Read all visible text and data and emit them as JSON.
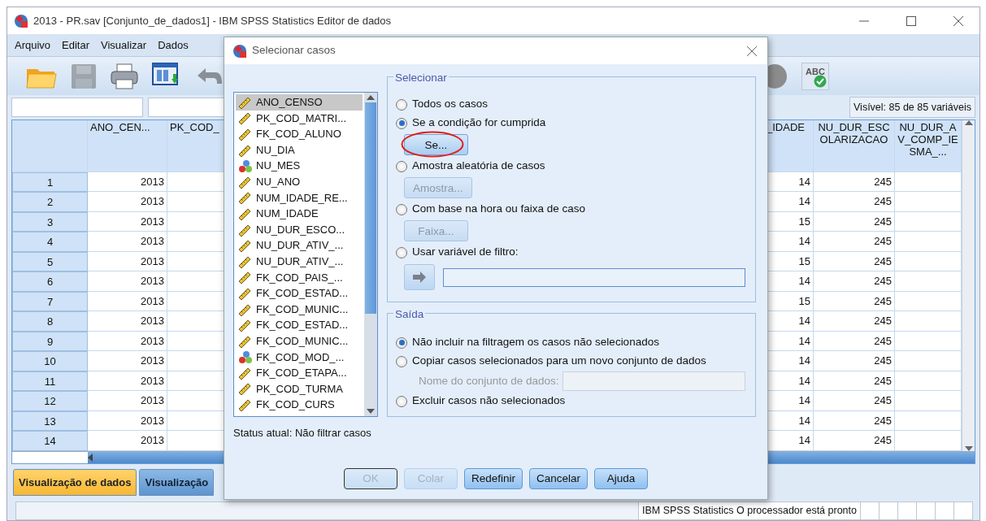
{
  "window": {
    "title": "2013 - PR.sav [Conjunto_de_dados1] - IBM SPSS Statistics Editor de dados"
  },
  "menu": [
    "Arquivo",
    "Editar",
    "Visualizar",
    "Dados"
  ],
  "toolbar": [
    {
      "kind": "open",
      "disabled": false
    },
    {
      "kind": "save",
      "disabled": true
    },
    {
      "kind": "print",
      "disabled": false
    },
    {
      "kind": "recall",
      "disabled": false
    },
    {
      "kind": "undo",
      "disabled": false
    },
    {
      "kind": "circle",
      "disabled": false
    },
    {
      "kind": "spell",
      "label": "ABC",
      "disabled": false
    }
  ],
  "visible_info": "Visível: 85 de 85 variáveis",
  "grid": {
    "columns": [
      "ANO_CEN...",
      "PK_COD_",
      "_IDADE",
      "NU_DUR_ESCOLARIZACAO",
      "NU_DUR_AV_COMP_IESMA_..."
    ],
    "rows": [
      {
        "number": "1",
        "ano_censo": "2013",
        "idade": "14",
        "dur": "245"
      },
      {
        "number": "2",
        "ano_censo": "2013",
        "idade": "14",
        "dur": "245"
      },
      {
        "number": "3",
        "ano_censo": "2013",
        "idade": "15",
        "dur": "245"
      },
      {
        "number": "4",
        "ano_censo": "2013",
        "idade": "14",
        "dur": "245"
      },
      {
        "number": "5",
        "ano_censo": "2013",
        "idade": "15",
        "dur": "245"
      },
      {
        "number": "6",
        "ano_censo": "2013",
        "idade": "14",
        "dur": "245"
      },
      {
        "number": "7",
        "ano_censo": "2013",
        "idade": "15",
        "dur": "245"
      },
      {
        "number": "8",
        "ano_censo": "2013",
        "idade": "14",
        "dur": "245"
      },
      {
        "number": "9",
        "ano_censo": "2013",
        "idade": "14",
        "dur": "245"
      },
      {
        "number": "10",
        "ano_censo": "2013",
        "idade": "14",
        "dur": "245"
      },
      {
        "number": "11",
        "ano_censo": "2013",
        "idade": "14",
        "dur": "245"
      },
      {
        "number": "12",
        "ano_censo": "2013",
        "idade": "14",
        "dur": "245"
      },
      {
        "number": "13",
        "ano_censo": "2013",
        "idade": "14",
        "dur": "245"
      },
      {
        "number": "14",
        "ano_censo": "2013",
        "idade": "14",
        "dur": "245"
      }
    ]
  },
  "tabs": [
    {
      "label": "Visualização de dados",
      "selected": true
    },
    {
      "label": "Visualização",
      "selected": false
    }
  ],
  "status_bar": "IBM SPSS Statistics O processador está pronto",
  "dialog": {
    "title": "Selecionar casos",
    "variables": [
      {
        "name": "ANO_CENSO",
        "kind": "scale",
        "selected": true
      },
      {
        "name": "PK_COD_MATRI...",
        "kind": "scale",
        "selected": false
      },
      {
        "name": "FK_COD_ALUNO",
        "kind": "scale",
        "selected": false
      },
      {
        "name": "NU_DIA",
        "kind": "scale",
        "selected": false
      },
      {
        "name": "NU_MES",
        "kind": "nominal",
        "selected": false
      },
      {
        "name": "NU_ANO",
        "kind": "scale",
        "selected": false
      },
      {
        "name": "NUM_IDADE_RE...",
        "kind": "scale",
        "selected": false
      },
      {
        "name": "NUM_IDADE",
        "kind": "scale",
        "selected": false
      },
      {
        "name": "NU_DUR_ESCO...",
        "kind": "scale",
        "selected": false
      },
      {
        "name": "NU_DUR_ATIV_...",
        "kind": "scale",
        "selected": false
      },
      {
        "name": "NU_DUR_ATIV_...",
        "kind": "scale",
        "selected": false
      },
      {
        "name": "FK_COD_PAIS_...",
        "kind": "scale",
        "selected": false
      },
      {
        "name": "FK_COD_ESTAD...",
        "kind": "scale",
        "selected": false
      },
      {
        "name": "FK_COD_MUNIC...",
        "kind": "scale",
        "selected": false
      },
      {
        "name": "FK_COD_ESTAD...",
        "kind": "scale",
        "selected": false
      },
      {
        "name": "FK_COD_MUNIC...",
        "kind": "scale",
        "selected": false
      },
      {
        "name": "FK_COD_MOD_...",
        "kind": "nominal",
        "selected": false
      },
      {
        "name": "FK_COD_ETAPA...",
        "kind": "scale",
        "selected": false
      },
      {
        "name": "PK_COD_TURMA",
        "kind": "scale",
        "selected": false
      },
      {
        "name": "FK_COD_CURS",
        "kind": "scale",
        "selected": false
      }
    ],
    "select": {
      "legend": "Selecionar",
      "options": [
        {
          "kind": "plain",
          "label": "Todos os casos",
          "selected": false
        },
        {
          "kind": "button",
          "label": "Se a condição for cumprida",
          "selected": true,
          "button": {
            "label": "Se...",
            "disabled": false,
            "highlighted": true
          }
        },
        {
          "kind": "button",
          "label": "Amostra aleatória de casos",
          "selected": false,
          "button": {
            "label": "Amostra...",
            "disabled": true,
            "highlighted": false
          }
        },
        {
          "kind": "button",
          "label": "Com base na hora ou faixa de caso",
          "selected": false,
          "button": {
            "label": "Faixa...",
            "disabled": true,
            "highlighted": false
          }
        },
        {
          "kind": "filter",
          "label": "Usar variável de filtro:",
          "selected": false
        }
      ]
    },
    "output": {
      "legend": "Saída",
      "options": [
        {
          "kind": "plain",
          "label": "Não incluir na filtragem os casos não selecionados",
          "selected": true
        },
        {
          "kind": "field",
          "label": "Copiar casos selecionados para um novo conjunto de dados",
          "selected": false,
          "field_label": "Nome do conjunto de dados:",
          "field_disabled": true
        },
        {
          "kind": "plain",
          "label": "Excluir casos não selecionados",
          "selected": false
        }
      ]
    },
    "status": "Status atual: Não filtrar casos",
    "buttons": [
      {
        "label": "OK",
        "disabled": true,
        "default": true
      },
      {
        "label": "Colar",
        "disabled": true,
        "default": false
      },
      {
        "label": "Redefinir",
        "disabled": false,
        "default": false
      },
      {
        "label": "Cancelar",
        "disabled": false,
        "default": false
      },
      {
        "label": "Ajuda",
        "disabled": false,
        "default": false
      }
    ]
  }
}
